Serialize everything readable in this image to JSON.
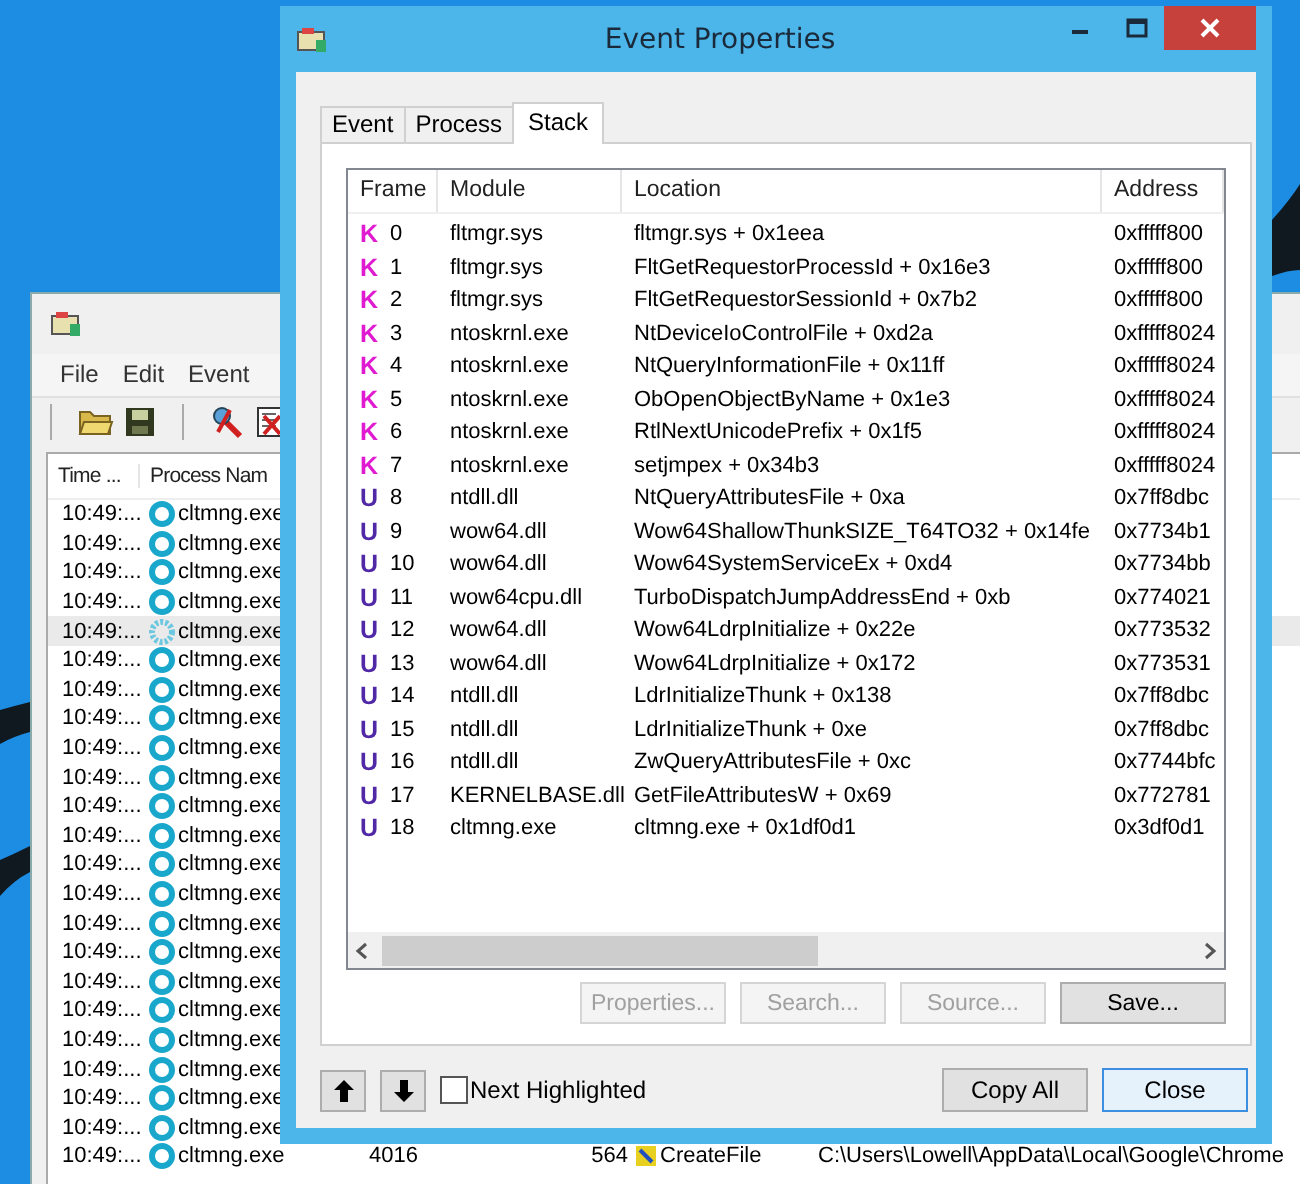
{
  "back_window": {
    "menu": [
      "File",
      "Edit",
      "Event"
    ],
    "columns": [
      "Time ...",
      "Process Nam"
    ],
    "rows": [
      {
        "time": "10:49:...",
        "process": "cltmng.exe",
        "selected": false
      },
      {
        "time": "10:49:...",
        "process": "cltmng.exe",
        "selected": false
      },
      {
        "time": "10:49:...",
        "process": "cltmng.exe",
        "selected": false
      },
      {
        "time": "10:49:...",
        "process": "cltmng.exe",
        "selected": false
      },
      {
        "time": "10:49:...",
        "process": "cltmng.exe",
        "selected": true
      },
      {
        "time": "10:49:...",
        "process": "cltmng.exe",
        "selected": false
      },
      {
        "time": "10:49:...",
        "process": "cltmng.exe",
        "selected": false
      },
      {
        "time": "10:49:...",
        "process": "cltmng.exe",
        "selected": false
      },
      {
        "time": "10:49:...",
        "process": "cltmng.exe",
        "selected": false
      },
      {
        "time": "10:49:...",
        "process": "cltmng.exe",
        "selected": false
      },
      {
        "time": "10:49:...",
        "process": "cltmng.exe",
        "selected": false
      },
      {
        "time": "10:49:...",
        "process": "cltmng.exe",
        "selected": false
      },
      {
        "time": "10:49:...",
        "process": "cltmng.exe",
        "selected": false
      },
      {
        "time": "10:49:...",
        "process": "cltmng.exe",
        "selected": false
      },
      {
        "time": "10:49:...",
        "process": "cltmng.exe",
        "selected": false
      },
      {
        "time": "10:49:...",
        "process": "cltmng.exe",
        "selected": false
      },
      {
        "time": "10:49:...",
        "process": "cltmng.exe",
        "selected": false
      },
      {
        "time": "10:49:...",
        "process": "cltmng.exe",
        "selected": false
      },
      {
        "time": "10:49:...",
        "process": "cltmng.exe",
        "selected": false
      },
      {
        "time": "10:49:...",
        "process": "cltmng.exe",
        "selected": false
      },
      {
        "time": "10:49:...",
        "process": "cltmng.exe",
        "selected": false
      },
      {
        "time": "10:49:...",
        "process": "cltmng.exe",
        "selected": false
      },
      {
        "time": "10:49:...",
        "process": "cltmng.exe",
        "selected": false,
        "column_3": "4016",
        "column_4": "564",
        "column_5": "CreateFile",
        "column_6": "C:\\Users\\Lowell\\AppData\\Local\\Google\\Chrome"
      }
    ]
  },
  "dialog": {
    "title": "Event Properties",
    "tabs": [
      {
        "label": "Event",
        "selected": false
      },
      {
        "label": "Process",
        "selected": false
      },
      {
        "label": "Stack",
        "selected": true
      }
    ],
    "table": {
      "columns": [
        "Frame",
        "Module",
        "Location",
        "Address"
      ],
      "rows": [
        {
          "kind": "kernel",
          "mode": "K",
          "frame": "0",
          "module": "fltmgr.sys",
          "location": "fltmgr.sys + 0x1eea",
          "address": "0xfffff800"
        },
        {
          "kind": "kernel",
          "mode": "K",
          "frame": "1",
          "module": "fltmgr.sys",
          "location": "FltGetRequestorProcessId + 0x16e3",
          "address": "0xfffff800"
        },
        {
          "kind": "kernel",
          "mode": "K",
          "frame": "2",
          "module": "fltmgr.sys",
          "location": "FltGetRequestorSessionId + 0x7b2",
          "address": "0xfffff800"
        },
        {
          "kind": "kernel",
          "mode": "K",
          "frame": "3",
          "module": "ntoskrnl.exe",
          "location": "NtDeviceIoControlFile + 0xd2a",
          "address": "0xfffff8024"
        },
        {
          "kind": "kernel",
          "mode": "K",
          "frame": "4",
          "module": "ntoskrnl.exe",
          "location": "NtQueryInformationFile + 0x11ff",
          "address": "0xfffff8024"
        },
        {
          "kind": "kernel",
          "mode": "K",
          "frame": "5",
          "module": "ntoskrnl.exe",
          "location": "ObOpenObjectByName + 0x1e3",
          "address": "0xfffff8024"
        },
        {
          "kind": "kernel",
          "mode": "K",
          "frame": "6",
          "module": "ntoskrnl.exe",
          "location": "RtlNextUnicodePrefix + 0x1f5",
          "address": "0xfffff8024"
        },
        {
          "kind": "kernel",
          "mode": "K",
          "frame": "7",
          "module": "ntoskrnl.exe",
          "location": "setjmpex + 0x34b3",
          "address": "0xfffff8024"
        },
        {
          "kind": "user",
          "mode": "U",
          "frame": "8",
          "module": "ntdll.dll",
          "location": "NtQueryAttributesFile + 0xa",
          "address": "0x7ff8dbc"
        },
        {
          "kind": "user",
          "mode": "U",
          "frame": "9",
          "module": "wow64.dll",
          "location": "Wow64ShallowThunkSIZE_T64TO32 + 0x14fe",
          "address": "0x7734b1"
        },
        {
          "kind": "user",
          "mode": "U",
          "frame": "10",
          "module": "wow64.dll",
          "location": "Wow64SystemServiceEx + 0xd4",
          "address": "0x7734bb"
        },
        {
          "kind": "user",
          "mode": "U",
          "frame": "11",
          "module": "wow64cpu.dll",
          "location": "TurboDispatchJumpAddressEnd + 0xb",
          "address": "0x774021"
        },
        {
          "kind": "user",
          "mode": "U",
          "frame": "12",
          "module": "wow64.dll",
          "location": "Wow64LdrpInitialize + 0x22e",
          "address": "0x773532"
        },
        {
          "kind": "user",
          "mode": "U",
          "frame": "13",
          "module": "wow64.dll",
          "location": "Wow64LdrpInitialize + 0x172",
          "address": "0x773531"
        },
        {
          "kind": "user",
          "mode": "U",
          "frame": "14",
          "module": "ntdll.dll",
          "location": "LdrInitializeThunk + 0x138",
          "address": "0x7ff8dbc"
        },
        {
          "kind": "user",
          "mode": "U",
          "frame": "15",
          "module": "ntdll.dll",
          "location": "LdrInitializeThunk + 0xe",
          "address": "0x7ff8dbc"
        },
        {
          "kind": "user",
          "mode": "U",
          "frame": "16",
          "module": "ntdll.dll",
          "location": "ZwQueryAttributesFile + 0xc",
          "address": "0x7744bfc"
        },
        {
          "kind": "user",
          "mode": "U",
          "frame": "17",
          "module": "KERNELBASE.dll",
          "location": "GetFileAttributesW + 0x69",
          "address": "0x772781"
        },
        {
          "kind": "user",
          "mode": "U",
          "frame": "18",
          "module": "cltmng.exe",
          "location": "cltmng.exe + 0x1df0d1",
          "address": "0x3df0d1"
        }
      ]
    },
    "panel_buttons": [
      {
        "label": "Properties...",
        "disabled": true
      },
      {
        "label": "Search...",
        "disabled": true
      },
      {
        "label": "Source...",
        "disabled": true
      },
      {
        "label": "Save...",
        "disabled": false
      }
    ],
    "next_highlighted": {
      "label": "Next Highlighted",
      "checked": false
    },
    "buttons": [
      {
        "label": "Copy All",
        "focused": false
      },
      {
        "label": "Close",
        "focused": true
      }
    ]
  }
}
